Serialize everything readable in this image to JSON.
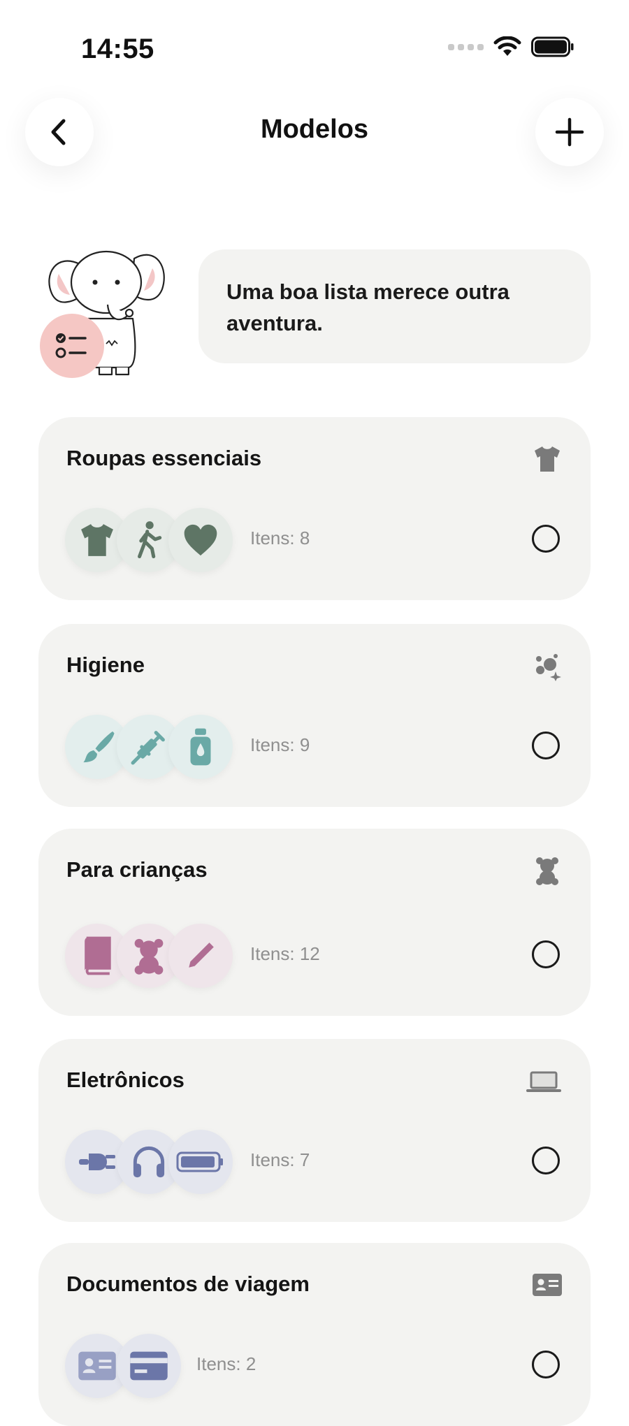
{
  "status_bar": {
    "time": "14:55"
  },
  "header": {
    "title": "Modelos"
  },
  "hero": {
    "message": "Uma boa lista merece outra aventura."
  },
  "colors": {
    "green": "#5e7565",
    "teal": "#6aa9a6",
    "pink": "#b06d93",
    "blue": "#6b76a8",
    "card_bg": "#f3f3f1",
    "badge": "#f5c7c4"
  },
  "templates": [
    {
      "title": "Roupas essenciais",
      "category_icon": "tshirt-icon",
      "items": "Itens: 8",
      "chip_icons": [
        "tshirt-icon",
        "walking-icon",
        "heart-icon"
      ]
    },
    {
      "title": "Higiene",
      "category_icon": "sparkles-icon",
      "items": "Itens: 9",
      "chip_icons": [
        "brush-icon",
        "syringe-icon",
        "bottle-icon"
      ]
    },
    {
      "title": "Para crianças",
      "category_icon": "teddy-bear-icon",
      "items": "Itens: 12",
      "chip_icons": [
        "book-icon",
        "teddy-bear-icon",
        "pencil-icon"
      ]
    },
    {
      "title": "Eletrônicos",
      "category_icon": "laptop-icon",
      "items": "Itens: 7",
      "chip_icons": [
        "plug-icon",
        "headphones-icon",
        "battery-icon"
      ]
    },
    {
      "title": "Documentos de viagem",
      "category_icon": "id-card-icon",
      "items": "Itens: 2",
      "chip_icons": [
        "id-card-icon",
        "credit-card-icon"
      ]
    }
  ]
}
